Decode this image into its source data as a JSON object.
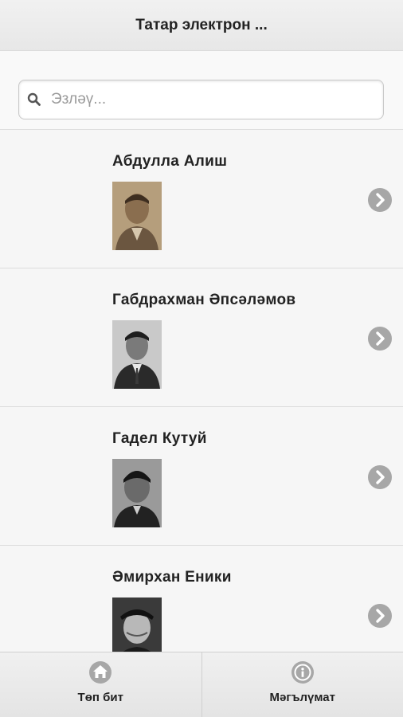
{
  "header": {
    "title": "Татар электрон ..."
  },
  "search": {
    "placeholder": "Эзләү..."
  },
  "list": {
    "items": [
      {
        "name": "Абдулла Алиш"
      },
      {
        "name": "Габдрахман Әпсәләмов"
      },
      {
        "name": "Гадел Кутуй"
      },
      {
        "name": "Әмирхан Еники"
      }
    ]
  },
  "footer": {
    "home_label": "Төп бит",
    "info_label": "Мәгълүмат"
  },
  "colors": {
    "icon_gray": "#a7a7a7",
    "header_bg": "#ececec"
  }
}
